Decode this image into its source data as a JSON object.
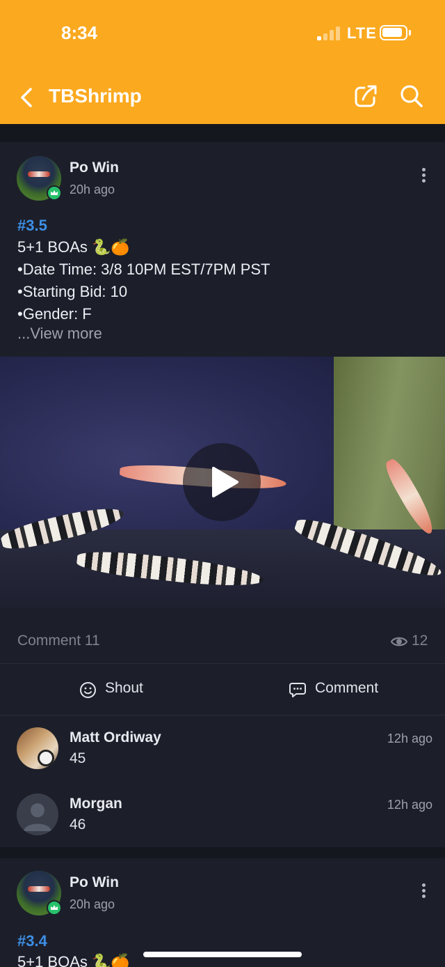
{
  "status_bar": {
    "time": "8:34",
    "network": "LTE"
  },
  "nav": {
    "title": "TBShrimp",
    "back_icon": "chevron-left-icon",
    "share_icon": "share-icon",
    "search_icon": "search-icon"
  },
  "post": {
    "author": "Po Win",
    "time": "20h ago",
    "tag": "#3.5",
    "lines": [
      "5+1 BOAs 🐍🍊",
      "•Date Time: 3/8 10PM EST/7PM PST",
      "•Starting Bid: 10",
      "•Gender: F"
    ],
    "view_more": "...View more",
    "stats": {
      "comments": "Comment 11",
      "views": "12"
    },
    "actions": {
      "shout": "Shout",
      "comment": "Comment"
    },
    "comments": [
      {
        "name": "Matt Ordiway",
        "text": "45",
        "time": "12h ago"
      },
      {
        "name": "Morgan",
        "text": "46",
        "time": "12h ago"
      }
    ]
  },
  "next_post": {
    "author": "Po Win",
    "time": "20h ago",
    "tag": "#3.4",
    "line": "5+1 BOAs 🐍🍊"
  },
  "colors": {
    "header": "#fba91f",
    "background": "#1c1f2a",
    "link": "#3d8fe6",
    "badge": "#27c26b"
  }
}
